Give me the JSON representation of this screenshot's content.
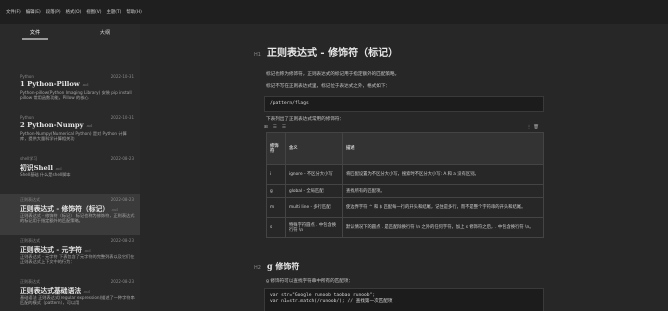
{
  "menubar": {
    "items": [
      "文件(F)",
      "编辑(E)",
      "段落(P)",
      "格式(O)",
      "视图(V)",
      "主题(T)",
      "帮助(H)"
    ]
  },
  "sidebar": {
    "tabs": [
      "文件",
      "大纲"
    ],
    "notes": [
      {
        "folder": "Python",
        "date": "2022-10-31",
        "title": "1 Python-Pillow",
        "ext": ".md",
        "excerpt": "Python-pillow(Python Imaging Library) 安装 pip install pillow 常用函数功能，Pillow 的核心",
        "active": false
      },
      {
        "folder": "Python",
        "date": "2022-10-31",
        "title": "2 Python-Numpy",
        "ext": ".md",
        "excerpt": "Python-Numpy(Numerical Python) 是对 Python 计算库，提供大量科学计算相关功",
        "active": false
      },
      {
        "folder": "shell学习",
        "date": "2022-08-23",
        "title": "初识Shell",
        "ext": ".md",
        "excerpt": "Shell基础 什么是shell脚本",
        "active": false
      },
      {
        "folder": "正则表达式",
        "date": "2022-08-23",
        "title": "正则表达式 - 修饰符（标记）",
        "ext": ".md",
        "excerpt": "正则表达式 - 修饰符（标记） 标记也称为修饰符，正则表达式的标记用于指定额外的匹配策略。",
        "active": true
      },
      {
        "folder": "正则表达式",
        "date": "2022-08-23",
        "title": "正则表达式 - 元字符",
        "ext": ".md",
        "excerpt": "正则表达式 - 元字符 下表包含了元字符的完整列表以及它们在正则表达式上下文中的行为：",
        "active": false
      },
      {
        "folder": "正则表达式",
        "date": "2022-08-23",
        "title": "正则表达式基础语法",
        "ext": ".md",
        "excerpt": "基础语法 正则表达式(regular expression)描述了一种字符串匹配的模式（pattern），可以用",
        "active": false
      }
    ]
  },
  "doc": {
    "h1": "正则表达式 - 修饰符（标记）",
    "h1_level": "H1",
    "p1": "标记也称为修饰符，正则表达式的标记用于指定额外的匹配策略。",
    "p2": "标记不写在正则表达式里，标记位于表达式之外，格式如下：",
    "code1": "/pattern/flags",
    "p3": "下表列出了正则表达式常用的修饰符：",
    "table_toolbar": [
      "⊞",
      "☰",
      "☰",
      "⋮",
      "🗑"
    ],
    "table_headers": [
      "修饰符",
      "含义",
      "描述"
    ],
    "table_rows": [
      [
        "i",
        "ignore - 不区分大小写",
        "将匹配设置为不区分大小写，搜索时不区分大小写: A 和 a 没有区别。"
      ],
      [
        "g",
        "global - 全局匹配",
        "查找所有的匹配项。"
      ],
      [
        "m",
        "multi line - 多行匹配",
        "使边界字符 ^ 和 $ 匹配每一行的开头和结尾，记住是多行，而不是整个字符串的开头和结尾。"
      ],
      [
        "s",
        "特殊字符圆点 . 中包含换行符 \\n",
        "默认情况下的圆点 . 是匹配除换行符 \\n 之外的任何字符，加上 s 修饰符之后，. 中包含换行符 \\n。"
      ]
    ],
    "h2": "g 修饰符",
    "h2_level": "H2",
    "p4": "g 修饰符可以查找字符串中所有的匹配项：",
    "code2": [
      "var str=\"Google runoob taobao runoob\";",
      "var n1=str.match(/runoob/);   // 查找第一次匹配项"
    ]
  }
}
